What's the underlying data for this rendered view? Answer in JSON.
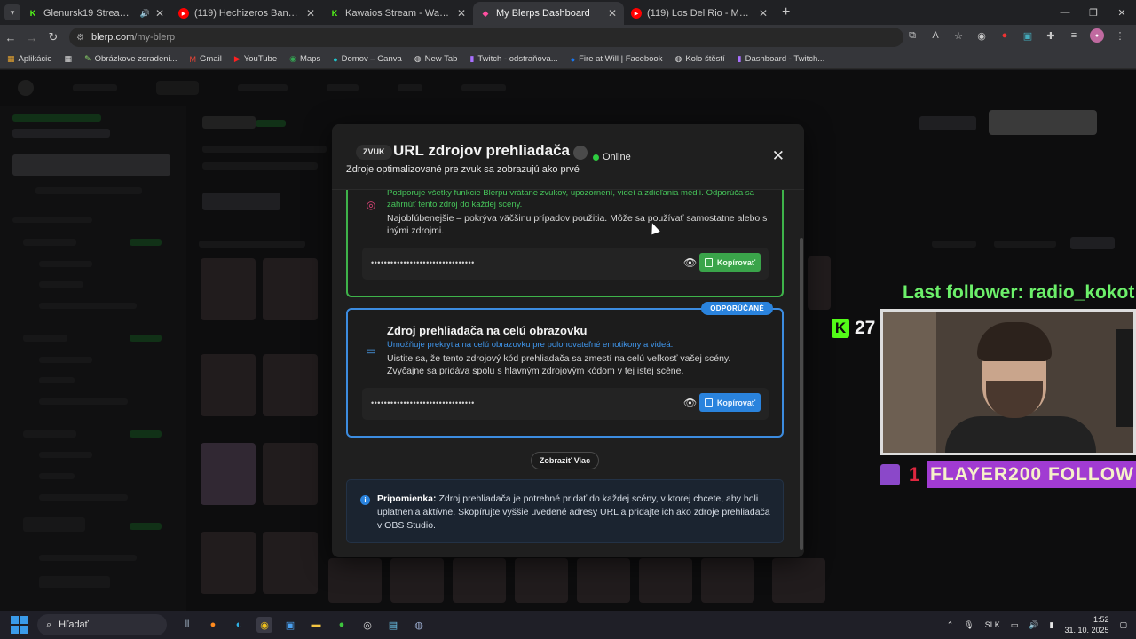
{
  "browser": {
    "tabs": [
      {
        "title": "Glenursk19 Stream - Watch",
        "icon": "kick-icon",
        "active": false,
        "audio": true
      },
      {
        "title": "(119) Hechizeros Band - El Son",
        "icon": "youtube-icon",
        "active": false
      },
      {
        "title": "Kawaios Stream - Watch Live o",
        "icon": "kick-icon",
        "active": false
      },
      {
        "title": "My Blerps Dashboard",
        "icon": "blerp-icon",
        "active": true
      },
      {
        "title": "(119) Los Del Rio - Macarena (",
        "icon": "youtube-icon",
        "active": false
      }
    ],
    "url_host": "blerp.com",
    "url_path": "/my-blerp",
    "bookmarks": [
      {
        "label": "Aplikácie",
        "icon": "apps-icon"
      },
      {
        "label": "Obrázkove zoradeni...",
        "icon": "pen-icon"
      },
      {
        "label": "Gmail",
        "icon": "gmail-icon"
      },
      {
        "label": "YouTube",
        "icon": "youtube-icon"
      },
      {
        "label": "Maps",
        "icon": "maps-icon"
      },
      {
        "label": "Domov – Canva",
        "icon": "canva-icon"
      },
      {
        "label": "New Tab",
        "icon": "globe-icon"
      },
      {
        "label": "Twitch - odstraňova...",
        "icon": "twitch-icon"
      },
      {
        "label": "Fire at Will | Facebook",
        "icon": "facebook-icon"
      },
      {
        "label": "Kolo štěstí",
        "icon": "globe-icon"
      },
      {
        "label": "Dashboard - Twitch...",
        "icon": "twitch-icon"
      }
    ]
  },
  "modal": {
    "badge": "ZVUK",
    "title": "URL zdrojov prehliadača",
    "status": "Online",
    "subtitle": "Zdroje optimalizované pre zvuk sa zobrazujú ako prvé",
    "card1": {
      "feature": "Podporuje všetky funkcie Blerpu vrátane zvukov, upozornení, videí a zdieľania médií. Odporúča sa zahrnúť tento zdroj do každej scény.",
      "description": "Najobľúbenejšie – pokrýva väčšinu prípadov použitia. Môže sa používať samostatne alebo s inými zdrojmi.",
      "masked_url": "••••••••••••••••••••••••••••••••",
      "copy_label": "Kopírovať"
    },
    "card2": {
      "badge": "ODPORÚČANÉ",
      "title": "Zdroj prehliadača na celú obrazovku",
      "feature": "Umožňuje prekrytia na celú obrazovku pre polohovateľné emotikony a videá.",
      "description": "Uistite sa, že tento zdrojový kód prehliadača sa zmestí na celú veľkosť vašej scény. Zvyčajne sa pridáva spolu s hlavným zdrojovým kódom v tej istej scéne.",
      "masked_url": "••••••••••••••••••••••••••••••••",
      "copy_label": "Kopírovať"
    },
    "show_more": "Zobraziť Viac",
    "note_label": "Pripomienka:",
    "note_text": " Zdroj prehliadača je potrebné pridať do každej scény, v ktorej chcete, aby boli uplatnenia aktívne. Skopírujte vyššie uvedené adresy URL a pridajte ich ako zdroje prehliadača v OBS Studio."
  },
  "stream_overlay": {
    "last_follower": "Last follower: radio_kokot",
    "kick_count": "27",
    "follow_count": "1",
    "follow_name": "FLAYER200 FOLLOW"
  },
  "taskbar": {
    "search_placeholder": "Hľadať",
    "language": "SLK",
    "time": "1:52",
    "date": "31. 10. 2025"
  },
  "colors": {
    "green_accent": "#3eb34a",
    "blue_accent": "#2a83dd",
    "follower_green": "#6cf06a",
    "follow_purple": "#a13bd2"
  }
}
